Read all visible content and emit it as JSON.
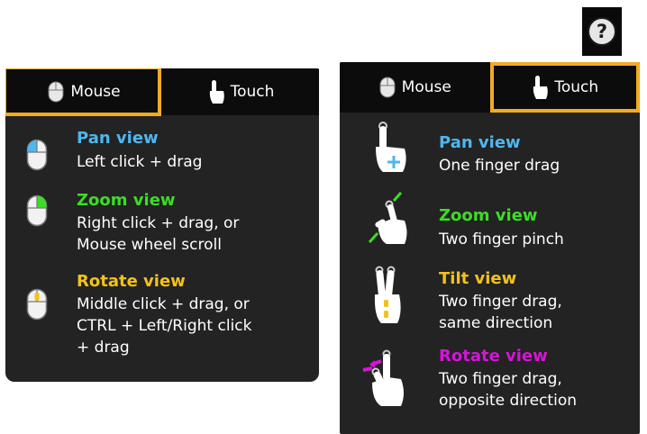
{
  "help": {
    "symbol": "?"
  },
  "colors": {
    "pan": "#4fb6ee",
    "zoom": "#3ddc26",
    "tilt_rotate_mouse": "#f3c21a",
    "rotate_touch": "#d514d9",
    "highlight": "#f2ab22",
    "panel": "#232323",
    "tabbar": "#0c0c0c"
  },
  "left_panel": {
    "tabs": [
      {
        "label": "Mouse",
        "icon": "mouse-icon",
        "highlighted": true
      },
      {
        "label": "Touch",
        "icon": "hand-icon",
        "highlighted": false
      }
    ],
    "items": [
      {
        "title": "Pan view",
        "icon": "mouse-left-button-icon",
        "lines": [
          "Left click + drag"
        ]
      },
      {
        "title": "Zoom view",
        "icon": "mouse-right-button-icon",
        "lines": [
          "Right click + drag, or",
          "Mouse wheel scroll"
        ]
      },
      {
        "title": "Rotate view",
        "icon": "mouse-middle-button-icon",
        "lines": [
          "Middle click + drag, or",
          "CTRL + Left/Right click",
          "+ drag"
        ]
      }
    ]
  },
  "right_panel": {
    "tabs": [
      {
        "label": "Mouse",
        "icon": "mouse-icon",
        "highlighted": false
      },
      {
        "label": "Touch",
        "icon": "hand-icon",
        "highlighted": true
      }
    ],
    "items": [
      {
        "title": "Pan view",
        "icon": "one-finger-drag-icon",
        "lines": [
          "One finger drag"
        ]
      },
      {
        "title": "Zoom view",
        "icon": "two-finger-pinch-icon",
        "lines": [
          "Two finger pinch"
        ]
      },
      {
        "title": "Tilt view",
        "icon": "two-finger-tilt-icon",
        "lines": [
          "Two finger drag,",
          "same direction"
        ]
      },
      {
        "title": "Rotate view",
        "icon": "two-finger-rotate-icon",
        "lines": [
          "Two finger drag,",
          "opposite direction"
        ]
      }
    ]
  }
}
